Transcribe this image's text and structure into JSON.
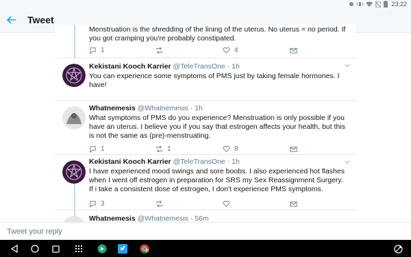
{
  "status_bar": {
    "time": "23:22",
    "icons": [
      "notification-icon",
      "vibrate-icon",
      "wifi-icon",
      "no-sim-icon",
      "battery-icon"
    ]
  },
  "app_bar": {
    "title": "Tweet",
    "back_icon": "arrow-left-icon"
  },
  "colors": {
    "accent": "#1da1f2",
    "text_primary": "#14171a",
    "text_secondary": "#657786",
    "divider": "#e1e8ed",
    "nav_bar": "#000000"
  },
  "tweets": [
    {
      "text": "Menstruation is the shredding of the lining of the uterus. No uterus = no period. If you got cramping you're probably constipated.",
      "replies": "1",
      "retweets": "",
      "likes": "4"
    },
    {
      "name": "Kekistani Kooch Karrier",
      "handle": "@TeleTransOne",
      "time": "1h",
      "text": "You can experience some symptoms of PMS just by taking female hormones. I have!"
    },
    {
      "name": "Whatnemesis",
      "handle": "@Whatnemesis",
      "time": "1h",
      "text": "What symptoms of PMS do you experience? Menstruation is only possible if you have an uterus. I believe you if you say that estrogen affects your health, but this is not the same as (pre)-menstruating.",
      "replies": "1",
      "retweets": "1",
      "likes": "8"
    },
    {
      "name": "Kekistani Kooch Karrier",
      "handle": "@TeleTransOne",
      "time": "1h",
      "text": "I have experienced mood swings and sore boobs. I also experienced hot flashes when I went off estrogen in preparation for SRS my Sex Reassignment Surgery. If i take a consistent dose of estrogen, I don't experience PMS symptoms.",
      "replies": "3",
      "retweets": "",
      "likes": ""
    },
    {
      "name": "Whatnemesis",
      "handle": "@Whatnemesis",
      "time": "56m"
    }
  ],
  "reply": {
    "placeholder": "Tweet your reply"
  },
  "nav_bar": {
    "buttons": [
      "back-triangle-icon",
      "home-circle-icon",
      "recents-square-icon",
      "app-drawer-icon",
      "play-store-icon",
      "twitter-app-icon",
      "chrome-icon",
      "screen-rotate-icon"
    ]
  }
}
